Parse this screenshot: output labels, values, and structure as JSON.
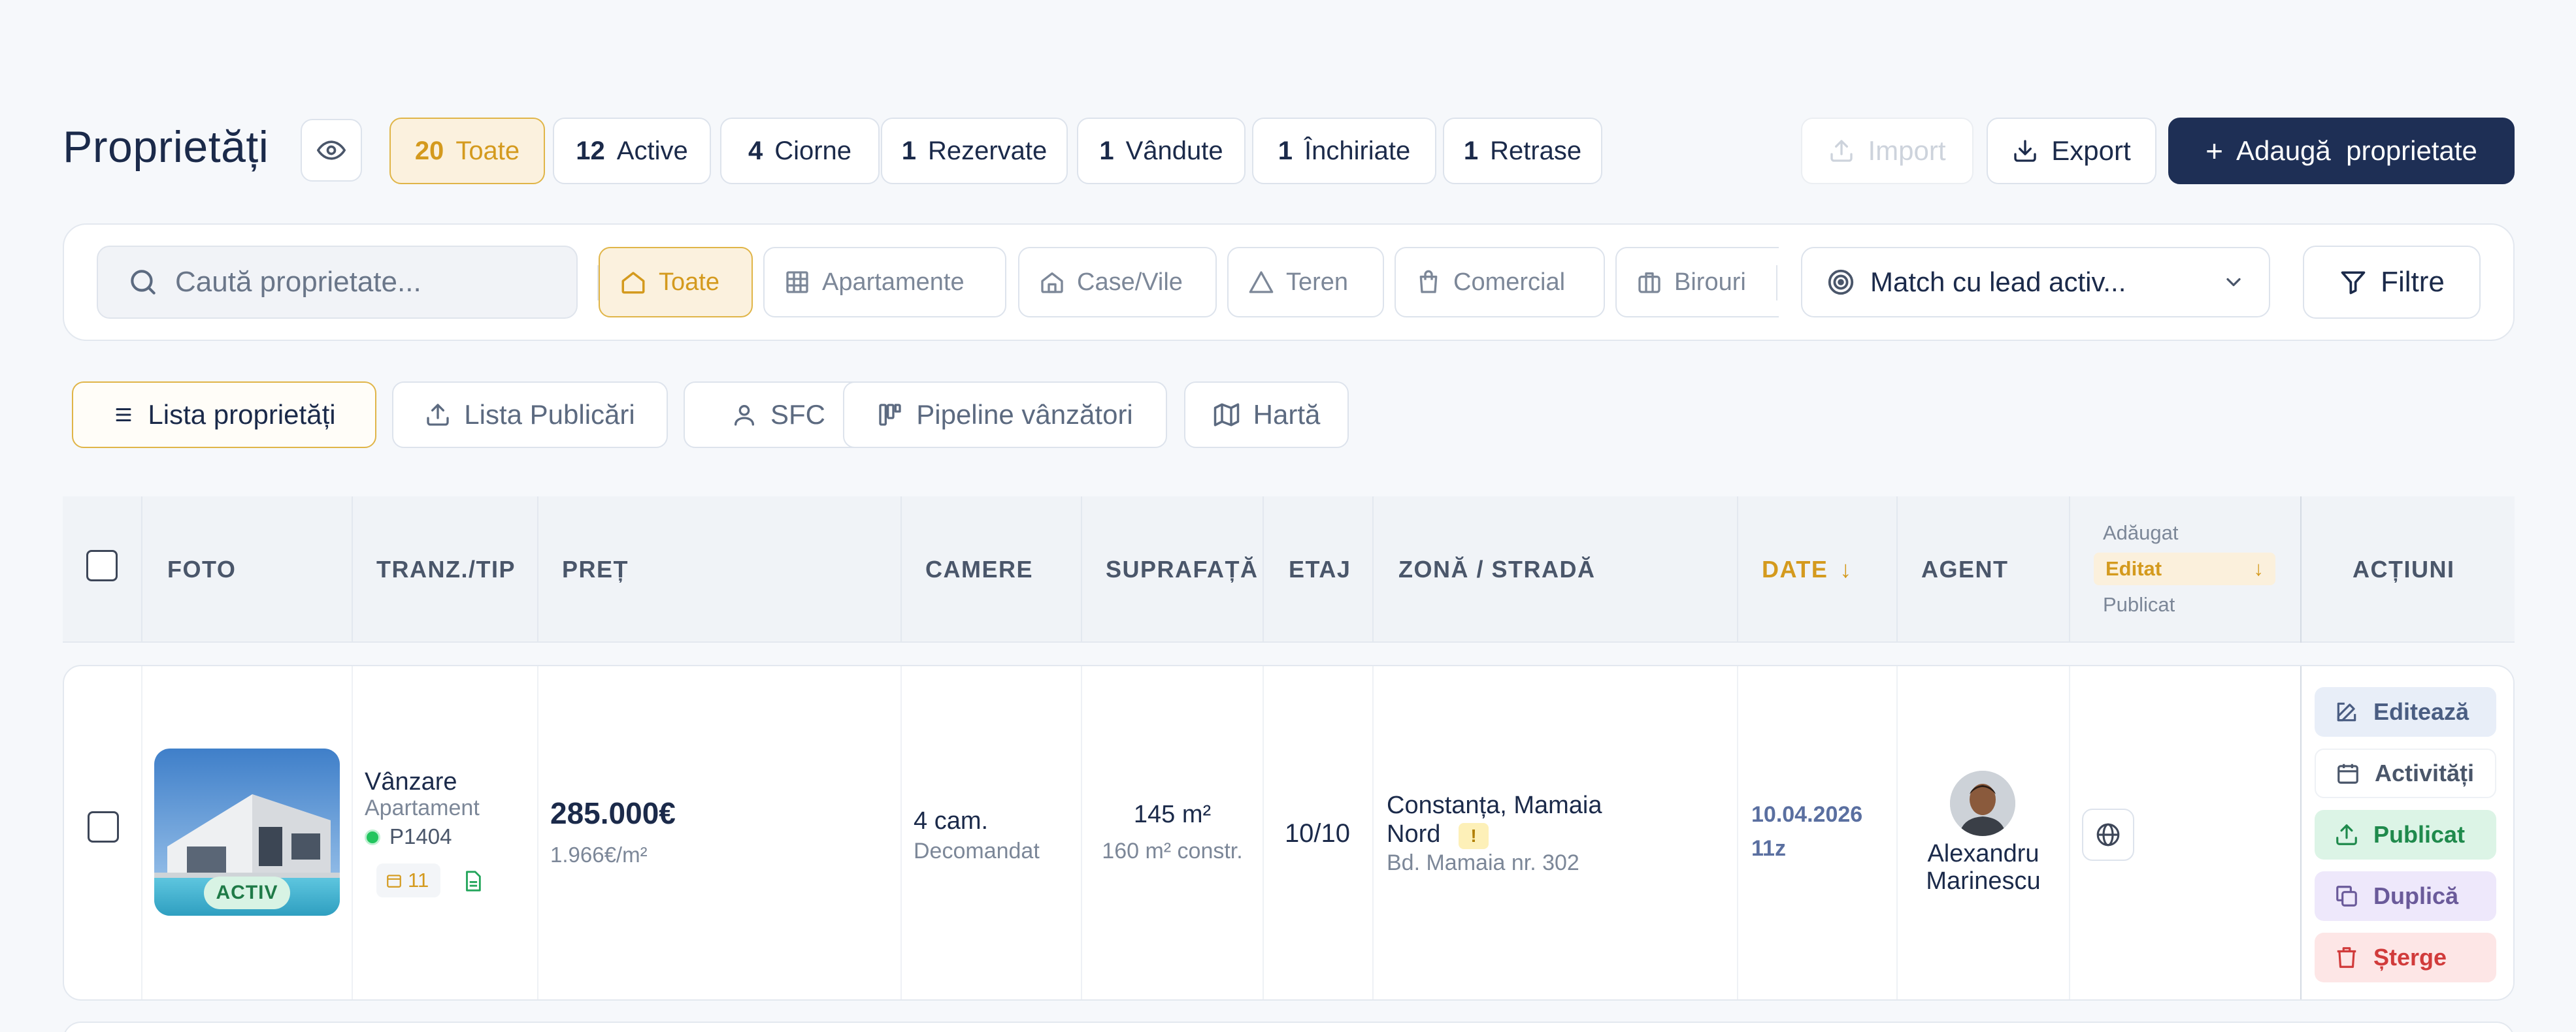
{
  "header": {
    "title": "Proprietăți",
    "status_chips": [
      {
        "count": "20",
        "label": "Toate"
      },
      {
        "count": "12",
        "label": "Active"
      },
      {
        "count": "4",
        "label": "Ciorne"
      },
      {
        "count": "1",
        "label": "Rezervate"
      },
      {
        "count": "1",
        "label": "Vândute"
      },
      {
        "count": "1",
        "label": "Închiriate"
      },
      {
        "count": "1",
        "label": "Retrase"
      }
    ],
    "import_label": "Import",
    "export_label": "Export",
    "add_label": "Adaugă  proprietate",
    "add_plus": "+"
  },
  "filters": {
    "search_placeholder": "Caută proprietate...",
    "property_types": [
      "Toate",
      "Apartamente",
      "Case/Vile",
      "Teren",
      "Comercial",
      "Birouri"
    ],
    "lead_match_label": "Match cu lead activ...",
    "filters_label": "Filtre"
  },
  "views": {
    "tabs": [
      "Lista proprietăți",
      "Lista Publicări",
      "SFC",
      "Pipeline vânzători",
      "Hartă"
    ]
  },
  "table": {
    "columns": {
      "foto": "FOTO",
      "tranz": "TRANZ./TIP",
      "pret": "PREȚ",
      "camere": "CAMERE",
      "suprafata": "SUPRAFAȚĂ",
      "etaj": "ETAJ",
      "zona": "ZONĂ / STRADĂ",
      "date": "DATE",
      "date_arrow": "↓",
      "agent": "AGENT",
      "actiuni": "ACȚIUNI"
    },
    "date_options": {
      "added": "Adăugat",
      "edited": "Editat",
      "edited_arrow": "↓",
      "published": "Publicat"
    },
    "rows": [
      {
        "status_badge": "ACTIV",
        "transaction": "Vânzare",
        "type": "Apartament",
        "code": "P1404",
        "photo_count": "11",
        "price": "285.000€",
        "price_per_sqm": "1.966€/m²",
        "rooms": "4 cam.",
        "layout": "Decomandat",
        "area": "145 m²",
        "built_area": "160 m² constr.",
        "floor": "10/10",
        "zone_line1": "Constanța, Mamaia",
        "zone_line2": "Nord",
        "zone_warning": "!",
        "street": "Bd. Mamaia nr. 302",
        "date": "10.04.2026",
        "date_age": "11z",
        "agent_first": "Alexandru",
        "agent_last": "Marinescu",
        "actions": {
          "edit": "Editează",
          "activities": "Activități",
          "published": "Publicat",
          "duplicate": "Duplică",
          "delete": "Șterge"
        }
      }
    ]
  },
  "colors": {
    "primary": "#1e2f55",
    "accent": "#d49a1e",
    "active_green": "#22c55e"
  }
}
